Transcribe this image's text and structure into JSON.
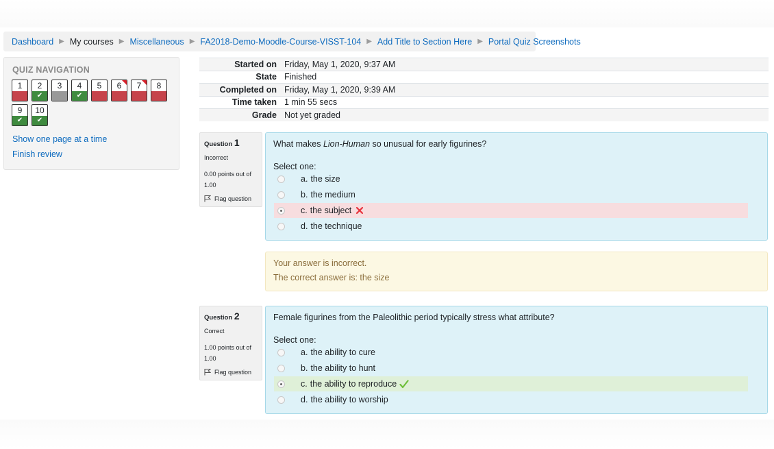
{
  "breadcrumb": [
    {
      "label": "Dashboard",
      "link": true
    },
    {
      "label": "My courses",
      "link": false
    },
    {
      "label": "Miscellaneous",
      "link": true
    },
    {
      "label": "FA2018-Demo-Moodle-Course-VISST-104",
      "link": true
    },
    {
      "label": "Add Title to Section Here",
      "link": true
    },
    {
      "label": "Portal Quiz Screenshots",
      "link": true
    }
  ],
  "quiz_nav": {
    "title": "QUIZ NAVIGATION",
    "buttons": [
      {
        "num": "1",
        "state": "incorrect",
        "flagged": false
      },
      {
        "num": "2",
        "state": "correct",
        "flagged": false
      },
      {
        "num": "3",
        "state": "notgraded",
        "flagged": false
      },
      {
        "num": "4",
        "state": "correct",
        "flagged": false
      },
      {
        "num": "5",
        "state": "incorrect",
        "flagged": false
      },
      {
        "num": "6",
        "state": "incorrect",
        "flagged": true
      },
      {
        "num": "7",
        "state": "incorrect",
        "flagged": true
      },
      {
        "num": "8",
        "state": "incorrect",
        "flagged": false
      },
      {
        "num": "9",
        "state": "correct",
        "flagged": false
      },
      {
        "num": "10",
        "state": "correct",
        "flagged": false
      }
    ],
    "show_one_page": "Show one page at a time",
    "finish_review": "Finish review"
  },
  "summary": [
    {
      "key": "Started on",
      "value": "Friday, May 1, 2020, 9:37 AM"
    },
    {
      "key": "State",
      "value": "Finished"
    },
    {
      "key": "Completed on",
      "value": "Friday, May 1, 2020, 9:39 AM"
    },
    {
      "key": "Time taken",
      "value": "1 min 55 secs"
    },
    {
      "key": "Grade",
      "value": "Not yet graded"
    }
  ],
  "q1": {
    "label": "Question",
    "number": "1",
    "state": "Incorrect",
    "grade_line1": "0.00 points out of",
    "grade_line2": "1.00",
    "flag": "Flag question",
    "text_before": "What makes ",
    "text_italic": "Lion-Human",
    "text_after": " so unusual for early figurines?",
    "prompt": "Select one:",
    "answers": [
      {
        "letter": "a.",
        "text": "the size"
      },
      {
        "letter": "b.",
        "text": "the medium"
      },
      {
        "letter": "c.",
        "text": "the subject"
      },
      {
        "letter": "d.",
        "text": "the technique"
      }
    ],
    "feedback": "Your answer is incorrect.",
    "correct_answer": "The correct answer is: the size"
  },
  "q2": {
    "label": "Question",
    "number": "2",
    "state": "Correct",
    "grade_line1": "1.00 points out of",
    "grade_line2": "1.00",
    "flag": "Flag question",
    "text": "Female figurines from the Paleolithic period typically stress what attribute?",
    "prompt": "Select one:",
    "answers": [
      {
        "letter": "a.",
        "text": "the ability to cure"
      },
      {
        "letter": "b.",
        "text": "the ability to hunt"
      },
      {
        "letter": "c.",
        "text": "the ability to reproduce"
      },
      {
        "letter": "d.",
        "text": "the ability to worship"
      }
    ]
  },
  "colors": {
    "link": "#0f6cbf",
    "incorrect": "#c6434b",
    "correct": "#3f8b3f",
    "question_bg": "#def2f8",
    "feedback_bg": "#fcf8e3"
  }
}
